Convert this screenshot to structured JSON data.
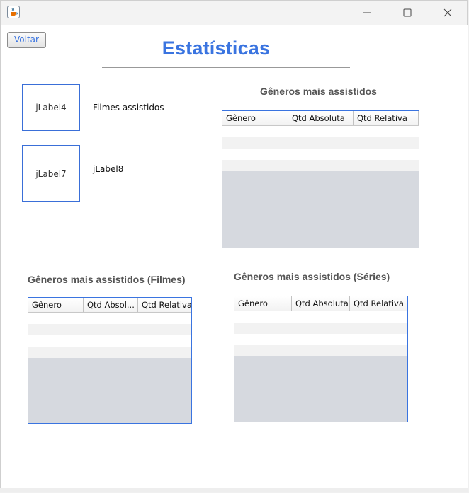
{
  "window": {
    "icon": "java-cup-icon",
    "controls": [
      "minimize-icon",
      "maximize-icon",
      "close-icon"
    ]
  },
  "toolbar": {
    "back_label": "Voltar"
  },
  "header": {
    "title": "Estatísticas"
  },
  "summary": {
    "watched_image_label": "jLabel4",
    "watched_text": "Filmes assistidos",
    "second_image_label": "jLabel7",
    "second_text": "jLabel8"
  },
  "tables": {
    "overall": {
      "title": "Gêneros mais assistidos",
      "columns": [
        "Gênero",
        "Qtd Absoluta",
        "Qtd Relativa"
      ]
    },
    "movies": {
      "title": "Gêneros mais assistidos (Filmes)",
      "columns": [
        "Gênero",
        "Qtd Absol...",
        "Qtd Relativa"
      ]
    },
    "series": {
      "title": "Gêneros mais assistidos (Séries)",
      "columns": [
        "Gênero",
        "Qtd Absoluta",
        "Qtd Relativa"
      ]
    }
  },
  "colors": {
    "accent": "#3a74e0",
    "empty_area": "#d6d9df"
  }
}
